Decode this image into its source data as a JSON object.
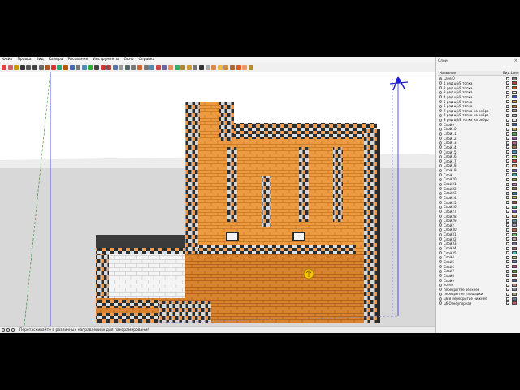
{
  "menu": [
    "Файл",
    "Правка",
    "Вид",
    "Камера",
    "Рисование",
    "Инструменты",
    "Окно",
    "Справка"
  ],
  "toolbar_icons": [
    "select-icon",
    "eraser-icon",
    "paint-bucket-icon",
    "line-icon",
    "arc-icon",
    "rectangle-icon",
    "circle-icon",
    "push-pull-icon",
    "move-icon",
    "rotate-icon",
    "scale-icon",
    "offset-icon",
    "tape-measure-icon",
    "dimension-icon",
    "protractor-icon",
    "text-icon",
    "axes-icon",
    "orbit-icon",
    "pan-icon",
    "zoom-icon",
    "zoom-extents-icon",
    "previous-view-icon",
    "section-plane-icon",
    "walk-icon",
    "look-around-icon",
    "iso-view-icon",
    "top-view-icon",
    "front-view-icon",
    "right-view-icon",
    "back-view-icon",
    "left-view-icon",
    "xray-icon",
    "wireframe-icon",
    "shaded-icon",
    "textured-icon",
    "monochrome-icon",
    "components-icon",
    "warehouse-icon",
    "extension-icon",
    "share-icon",
    "layers-icon"
  ],
  "toolbar_colors": [
    "#d44",
    "#c66",
    "#c90",
    "#333",
    "#555",
    "#444",
    "#666",
    "#a52",
    "#d33",
    "#2a7",
    "#b50",
    "#46a",
    "#777",
    "#58b",
    "#3a3",
    "#444",
    "#c33",
    "#a44",
    "#57a",
    "#999",
    "#566",
    "#777",
    "#c63",
    "#777",
    "#58a",
    "#c44",
    "#669",
    "#e85",
    "#3a6",
    "#a83",
    "#c93",
    "#777",
    "#333",
    "#aaa",
    "#d84",
    "#eb4",
    "#c84",
    "#a63",
    "#d52",
    "#e96",
    "#b83"
  ],
  "status": {
    "hint": "Перетаскивайте в различных направлениях для панорамирования"
  },
  "panel": {
    "title": "Слои",
    "close": "×",
    "col_name": "Название",
    "col_visible": "Вид...",
    "col_color": "Цвет"
  },
  "layers": [
    {
      "name": "Layer0",
      "active": true,
      "color": "#808080"
    },
    {
      "name": "1 ряд ц6/8 топка",
      "active": false,
      "color": "#c0392b"
    },
    {
      "name": "2 ряд ц6/8 топка",
      "active": false,
      "color": "#c05010"
    },
    {
      "name": "3 ряд ц6/8 топка",
      "active": false,
      "color": "#f0f0f0"
    },
    {
      "name": "4 ряд ц6/8 топка",
      "active": false,
      "color": "#3050c0"
    },
    {
      "name": "5 ряд ц6/8 топка",
      "active": false,
      "color": "#d0a030"
    },
    {
      "name": "6 ряд ц6/8 топка",
      "active": false,
      "color": "#c08030"
    },
    {
      "name": "7 ряд ц6/8 топка на ребро",
      "active": false,
      "color": "#a0a0a0"
    },
    {
      "name": "7 ряд ц6/8 топка на ребро",
      "active": false,
      "color": "#c0c0c0"
    },
    {
      "name": "8 ряд ц6/8 топка на ребро",
      "active": false,
      "color": "#e0e0e0"
    },
    {
      "name": "Слой9",
      "active": false,
      "color": "#3060a0"
    },
    {
      "name": "Слой10",
      "active": false,
      "color": "#c0a060"
    },
    {
      "name": "Слой11",
      "active": false,
      "color": "#50a050"
    },
    {
      "name": "Слой12",
      "active": false,
      "color": "#8050a0"
    },
    {
      "name": "Слой13",
      "active": false,
      "color": "#c06090"
    },
    {
      "name": "Слой14",
      "active": false,
      "color": "#a07040"
    },
    {
      "name": "Слой15",
      "active": false,
      "color": "#4090c0"
    },
    {
      "name": "Слой16",
      "active": false,
      "color": "#90c040"
    },
    {
      "name": "Слой17",
      "active": false,
      "color": "#c04040"
    },
    {
      "name": "Слой18",
      "active": false,
      "color": "#e09050"
    },
    {
      "name": "Слой19",
      "active": false,
      "color": "#6060c0"
    },
    {
      "name": "Слой1",
      "active": false,
      "color": "#40a0a0"
    },
    {
      "name": "Слой20",
      "active": false,
      "color": "#a0a040"
    },
    {
      "name": "Слой21",
      "active": false,
      "color": "#c080c0"
    },
    {
      "name": "Слой22",
      "active": false,
      "color": "#808040"
    },
    {
      "name": "Слой23",
      "active": false,
      "color": "#4080c0"
    },
    {
      "name": "Слой24",
      "active": false,
      "color": "#c0c040"
    },
    {
      "name": "Слой25",
      "active": false,
      "color": "#a05050"
    },
    {
      "name": "Слой26",
      "active": false,
      "color": "#50a080"
    },
    {
      "name": "Слой27",
      "active": false,
      "color": "#8050c0"
    },
    {
      "name": "Слой28",
      "active": false,
      "color": "#c09050"
    },
    {
      "name": "Слой29",
      "active": false,
      "color": "#5090a0"
    },
    {
      "name": "Слой2",
      "active": false,
      "color": "#a0a0c0"
    },
    {
      "name": "Слой30",
      "active": false,
      "color": "#c06040"
    },
    {
      "name": "Слой31",
      "active": false,
      "color": "#60c060"
    },
    {
      "name": "Слой32",
      "active": false,
      "color": "#c0a0a0"
    },
    {
      "name": "Слой33",
      "active": false,
      "color": "#7070a0"
    },
    {
      "name": "Слой34",
      "active": false,
      "color": "#a07070"
    },
    {
      "name": "Слой35",
      "active": false,
      "color": "#50c0c0"
    },
    {
      "name": "Слой4",
      "active": false,
      "color": "#c0c080"
    },
    {
      "name": "Слой5",
      "active": false,
      "color": "#8080c0"
    },
    {
      "name": "Слой6",
      "active": false,
      "color": "#c05080"
    },
    {
      "name": "Слой7",
      "active": false,
      "color": "#60a040"
    },
    {
      "name": "Слой8",
      "active": false,
      "color": "#a06040"
    },
    {
      "name": "Слой9",
      "active": false,
      "color": "#4060a0"
    },
    {
      "name": "котел",
      "active": false,
      "color": "#c08080"
    },
    {
      "name": "перекрытие верхнее",
      "active": false,
      "color": "#8090a0"
    },
    {
      "name": "перекрытие площадки",
      "active": false,
      "color": "#a0a060"
    },
    {
      "name": "ц6 8 перекрытие нижнее",
      "active": false,
      "color": "#6080a0"
    },
    {
      "name": "ц6 Огнеупорная",
      "active": false,
      "color": "#c06060"
    }
  ]
}
